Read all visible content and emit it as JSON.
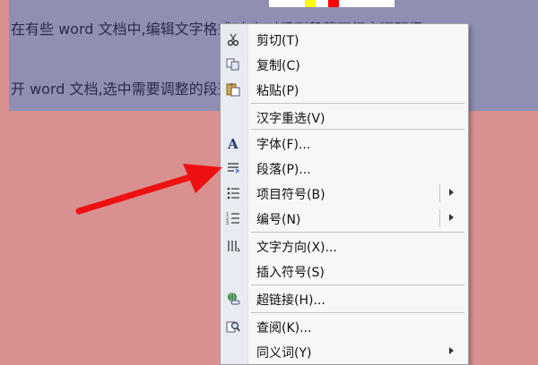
{
  "document": {
    "line1": "在有些 word 文档中,编辑文字格式时,有时看到段落开行字间距很",
    "line2": "开 word 文档,选中需要调整的段落,单击右键,在右键显示的菜"
  },
  "colors": {
    "selection": "#8f8fb4",
    "page_bg": "#d89090",
    "arrow": "#ee1111"
  },
  "context_menu": {
    "cut": {
      "label": "剪切(T)",
      "icon": "scissors-icon"
    },
    "copy": {
      "label": "复制(C)",
      "icon": "copy-icon"
    },
    "paste": {
      "label": "粘贴(P)",
      "icon": "paste-icon"
    },
    "reconvert": {
      "label": "汉字重选(V)"
    },
    "font": {
      "label": "字体(F)...",
      "icon": "font-icon"
    },
    "paragraph": {
      "label": "段落(P)...",
      "icon": "paragraph-icon"
    },
    "bullets": {
      "label": "项目符号(B)",
      "icon": "bullets-icon"
    },
    "numbering": {
      "label": "编号(N)",
      "icon": "numbering-icon"
    },
    "text_direction": {
      "label": "文字方向(X)...",
      "icon": "text-direction-icon"
    },
    "insert_symbol": {
      "label": "插入符号(S)"
    },
    "hyperlink": {
      "label": "超链接(H)...",
      "icon": "hyperlink-icon"
    },
    "lookup": {
      "label": "查阅(K)...",
      "icon": "lookup-icon"
    },
    "synonyms": {
      "label": "同义词(Y)"
    }
  }
}
